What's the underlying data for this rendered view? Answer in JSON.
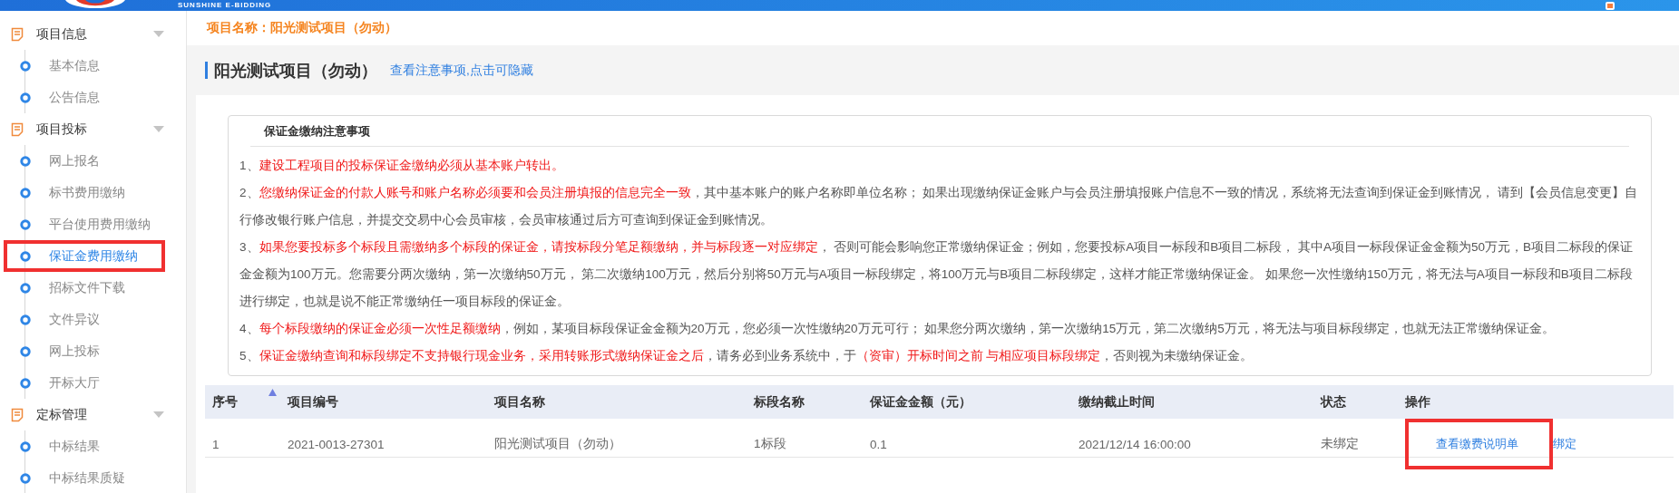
{
  "header": {
    "logo_text": "SUNSHINE E-BIDDING"
  },
  "sidebar": {
    "groups": [
      {
        "label": "项目信息",
        "expanded": true,
        "items": [
          {
            "label": "基本信息",
            "selected": false
          },
          {
            "label": "公告信息",
            "selected": false
          }
        ]
      },
      {
        "label": "项目投标",
        "expanded": true,
        "items": [
          {
            "label": "网上报名",
            "selected": false
          },
          {
            "label": "标书费用缴纳",
            "selected": false
          },
          {
            "label": "平台使用费用缴纳",
            "selected": false
          },
          {
            "label": "保证金费用缴纳",
            "selected": true,
            "highlighted": true
          },
          {
            "label": "招标文件下载",
            "selected": false
          },
          {
            "label": "文件异议",
            "selected": false
          },
          {
            "label": "网上投标",
            "selected": false
          },
          {
            "label": "开标大厅",
            "selected": false
          }
        ]
      },
      {
        "label": "定标管理",
        "expanded": true,
        "items": [
          {
            "label": "中标结果",
            "selected": false
          },
          {
            "label": "中标结果质疑",
            "selected": false
          }
        ]
      }
    ]
  },
  "breadcrumb": "项目名称：阳光测试项目（勿动）",
  "page_title": "阳光测试项目（勿动）",
  "toggle_link": "查看注意事项,点击可隐藏",
  "notice": {
    "title": "保证金缴纳注意事项",
    "items": [
      [
        {
          "text": "1、",
          "red": false
        },
        {
          "text": "建设工程项目的投标保证金缴纳必须从基本账户转出。",
          "red": true
        }
      ],
      [
        {
          "text": "2、",
          "red": false
        },
        {
          "text": "您缴纳保证金的付款人账号和账户名称必须要和会员注册填报的信息完全一致",
          "red": true
        },
        {
          "text": "，其中基本账户的账户名称即单位名称； 如果出现缴纳保证金账户与会员注册填报账户信息不一致的情况，系统将无法查询到保证金到账情况， 请到【会员信息变更】自行修改银行账户信息，并提交交易中心会员审核，会员审核通过后方可查询到保证金到账情况。",
          "red": false
        }
      ],
      [
        {
          "text": "3、",
          "red": false
        },
        {
          "text": "如果您要投标多个标段且需缴纳多个标段的保证金，请按标段分笔足额缴纳，并与标段逐一对应绑定",
          "red": true
        },
        {
          "text": "， 否则可能会影响您正常缴纳保证金；例如，您要投标A项目一标段和B项目二标段， 其中A项目一标段保证金金额为50万元，B项目二标段的保证金金额为100万元。您需要分两次缴纳，第一次缴纳50万元， 第二次缴纳100万元，然后分别将50万元与A项目一标段绑定，将100万元与B项目二标段绑定，这样才能正常缴纳保证金。 如果您一次性缴纳150万元，将无法与A项目一标段和B项目二标段进行绑定，也就是说不能正常缴纳任一项目标段的保证金。",
          "red": false
        }
      ],
      [
        {
          "text": "4、",
          "red": false
        },
        {
          "text": "每个标段缴纳的保证金必须一次性足额缴纳",
          "red": true
        },
        {
          "text": "，例如，某项目标段保证金金额为20万元，您必须一次性缴纳20万元可行； 如果您分两次缴纳，第一次缴纳15万元，第二次缴纳5万元，将无法与项目标段绑定，也就无法正常缴纳保证金。",
          "red": false
        }
      ],
      [
        {
          "text": "5、",
          "red": false
        },
        {
          "text": "保证金缴纳查询和标段绑定不支持银行现金业务，采用转账形式缴纳保证金之后",
          "red": true
        },
        {
          "text": "，请务必到业务系统中，于",
          "red": false
        },
        {
          "text": "（资审）开标时间之前 与相应项目标段绑定",
          "red": true
        },
        {
          "text": "，否则视为未缴纳保证金。",
          "red": false
        }
      ]
    ]
  },
  "table": {
    "columns": [
      {
        "label": "序号",
        "sorted": true
      },
      {
        "label": "项目编号",
        "sorted": false
      },
      {
        "label": "项目名称",
        "sorted": false
      },
      {
        "label": "标段名称",
        "sorted": false
      },
      {
        "label": "保证金金额（元）",
        "sorted": false
      },
      {
        "label": "缴纳截止时间",
        "sorted": false
      },
      {
        "label": "状态",
        "sorted": false
      },
      {
        "label": "操作",
        "sorted": false
      }
    ],
    "rows": [
      {
        "cells": [
          "1",
          "2021-0013-27301",
          "阳光测试项目（勿动）",
          "1标段",
          "0.1",
          "2021/12/14 16:00:00",
          "未绑定"
        ],
        "actions": [
          {
            "label": "查看缴费说明单",
            "highlighted": true
          },
          {
            "label": "绑定",
            "highlighted": false
          }
        ]
      }
    ]
  }
}
